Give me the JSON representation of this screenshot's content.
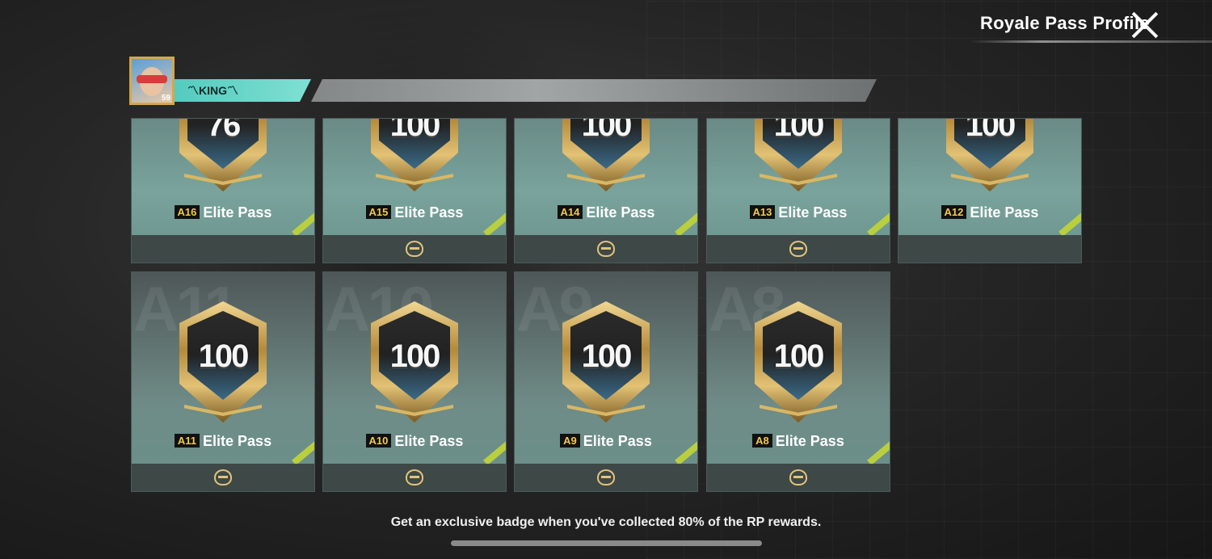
{
  "header": {
    "title": "Royale Pass Profile",
    "rank": "KING",
    "player_level": "59"
  },
  "cards_row1": [
    {
      "number": "76",
      "season": "A16",
      "label": "Elite Pass",
      "has_medal": false
    },
    {
      "number": "100",
      "season": "A15",
      "label": "Elite Pass",
      "has_medal": true
    },
    {
      "number": "100",
      "season": "A14",
      "label": "Elite Pass",
      "has_medal": true
    },
    {
      "number": "100",
      "season": "A13",
      "label": "Elite Pass",
      "has_medal": true
    },
    {
      "number": "100",
      "season": "A12",
      "label": "Elite Pass",
      "has_medal": false
    }
  ],
  "cards_row2": [
    {
      "number": "100",
      "season": "A11",
      "label": "Elite Pass",
      "watermark": "A11",
      "has_medal": true
    },
    {
      "number": "100",
      "season": "A10",
      "label": "Elite Pass",
      "watermark": "A10",
      "has_medal": true
    },
    {
      "number": "100",
      "season": "A9",
      "label": "Elite Pass",
      "watermark": "A9",
      "has_medal": true
    },
    {
      "number": "100",
      "season": "A8",
      "label": "Elite Pass",
      "watermark": "A8",
      "has_medal": true
    }
  ],
  "footer": {
    "hint": "Get an exclusive badge when you've collected 80% of the RP rewards."
  },
  "colors": {
    "accent_teal": "#52c9bd",
    "gold": "#d2a84e",
    "season_tag": "#f2c94c"
  }
}
